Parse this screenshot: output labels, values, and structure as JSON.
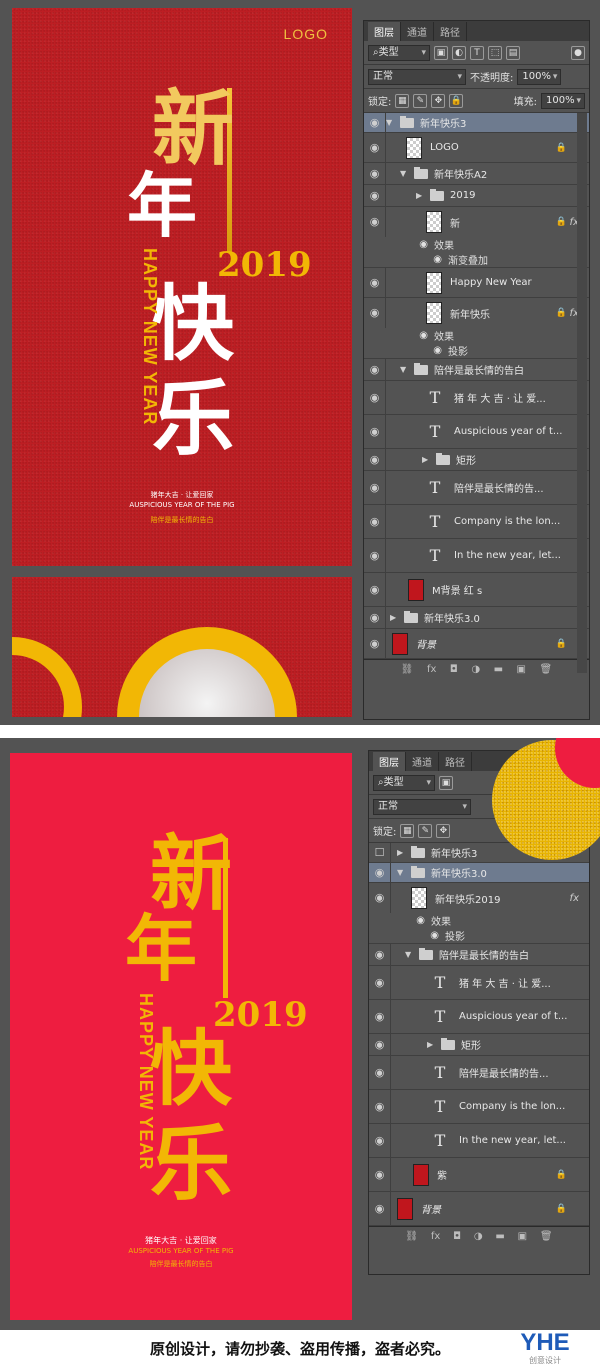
{
  "poster_top": {
    "logo": "LOGO",
    "title_chars": [
      "新",
      "年",
      "快",
      "乐"
    ],
    "year": "2019",
    "vertical_text": "HAPPY NEW YEAR",
    "small_lines": [
      "猪年大吉 · 让爱回家",
      "AUSPICIOUS YEAR OF THE PIG",
      "陪伴是最长情的告白"
    ]
  },
  "poster_bottom": {
    "title_chars": [
      "新",
      "年",
      "快",
      "乐"
    ],
    "year": "2019",
    "vertical_text": "HAPPY NEW YEAR",
    "small_lines": [
      "猪年大吉 · 让爱回家",
      "AUSPICIOUS YEAR OF THE PIG",
      "陪伴是最长情的告白"
    ]
  },
  "panel1": {
    "tabs": [
      "图层",
      "通道",
      "路径"
    ],
    "filter_label": "类型",
    "blend_mode": "正常",
    "opacity_label": "不透明度:",
    "opacity_value": "100%",
    "lock_label": "锁定:",
    "fill_label": "填充:",
    "fill_value": "100%",
    "layers": {
      "g1": "新年快乐3",
      "logo": "LOGO",
      "g2": "新年快乐A2",
      "g3": "2019",
      "xin": "新",
      "effect1": "效果",
      "effect1_sub": "渐变叠加",
      "hny": "Happy New Year",
      "xnkl": "新年快乐",
      "effect2": "效果",
      "effect2_sub": "投影",
      "g4": "陪伴是最长情的告白",
      "t1": "猪 年 大 吉 · 让 爱...",
      "t2": "Auspicious year of t...",
      "g5": "矩形",
      "t3": "陪伴是最长情的告...",
      "t4": "Company is the lon...",
      "t5": "In the new year, let...",
      "bg1": "M背景 红 s",
      "g6": "新年快乐3.0",
      "bg2": "背景"
    }
  },
  "panel2": {
    "tabs": [
      "图层",
      "通道",
      "路径"
    ],
    "filter_label": "类型",
    "blend_mode": "正常",
    "lock_label": "锁定:",
    "layers": {
      "g1": "新年快乐3",
      "g2": "新年快乐3.0",
      "xnkl": "新年快乐2019",
      "effect": "效果",
      "effect_sub": "投影",
      "g3": "陪伴是最长情的告白",
      "t1": "猪 年 大 吉 · 让 爱...",
      "t2": "Auspicious year of t...",
      "g4": "矩形",
      "t3": "陪伴是最长情的告...",
      "t4": "Company is the lon...",
      "t5": "In the new year, let...",
      "zi": "紫",
      "bg": "背景"
    }
  },
  "footer": {
    "notice": "原创设计，请勿抄袭、盗用传播，盗者必究。",
    "brand": "YHE",
    "brand_sub": "创意设计"
  },
  "colors": {
    "poster_red": "#bd1e23",
    "poster_pink": "#ee1d40",
    "gold": "#f2b705",
    "ps_bg": "#535353",
    "selected": "#6e7b8f"
  }
}
